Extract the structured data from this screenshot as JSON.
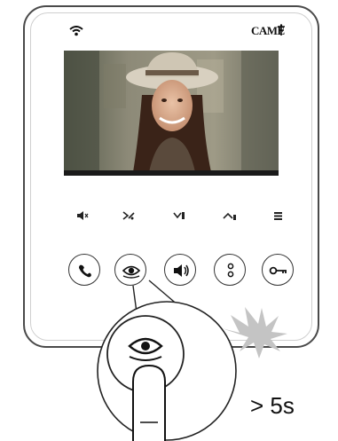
{
  "brand": {
    "name": "CAME"
  },
  "status": {
    "wifi_icon": "wifi-icon"
  },
  "indicators": [
    {
      "name": "indicator-1"
    },
    {
      "name": "indicator-2"
    },
    {
      "name": "indicator-3"
    },
    {
      "name": "indicator-4"
    },
    {
      "name": "indicator-5"
    }
  ],
  "buttons": [
    {
      "name": "call-button",
      "icon": "handset-icon"
    },
    {
      "name": "camera-button",
      "icon": "eye-icon"
    },
    {
      "name": "volume-button",
      "icon": "speaker-icon"
    },
    {
      "name": "menu-button",
      "icon": "dots-icon"
    },
    {
      "name": "door-open-button",
      "icon": "key-icon"
    }
  ],
  "instruction": {
    "hold_duration": "> 5s"
  },
  "colors": {
    "frame": "#4a4a4a",
    "glow": "#bdbdbd"
  }
}
